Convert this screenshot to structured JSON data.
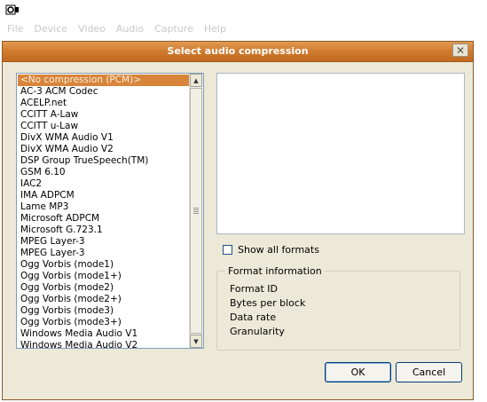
{
  "app": {
    "menu": [
      "File",
      "Device",
      "Video",
      "Audio",
      "Capture",
      "Help"
    ]
  },
  "dialog": {
    "title": "Select audio compression",
    "close_label": "✕",
    "codecs": [
      "<No compression (PCM)>",
      "AC-3 ACM Codec",
      "ACELP.net",
      "CCITT A-Law",
      "CCITT u-Law",
      "DivX WMA Audio V1",
      "DivX WMA Audio V2",
      "DSP Group TrueSpeech(TM)",
      "GSM 6.10",
      "IAC2",
      "IMA ADPCM",
      "Lame MP3",
      "Microsoft ADPCM",
      "Microsoft G.723.1",
      "MPEG Layer-3",
      "MPEG Layer-3",
      "Ogg Vorbis (mode1)",
      "Ogg Vorbis (mode1+)",
      "Ogg Vorbis (mode2)",
      "Ogg Vorbis (mode2+)",
      "Ogg Vorbis (mode3)",
      "Ogg Vorbis (mode3+)",
      "Windows Media Audio V1",
      "Windows Media Audio V2"
    ],
    "selected_index": 0,
    "show_all_formats_label": "Show all formats",
    "show_all_formats_checked": false,
    "format_info": {
      "legend": "Format information",
      "format_id": "Format ID",
      "bytes_per_block": "Bytes per block",
      "data_rate": "Data rate",
      "granularity": "Granularity"
    },
    "ok_label": "OK",
    "cancel_label": "Cancel"
  }
}
